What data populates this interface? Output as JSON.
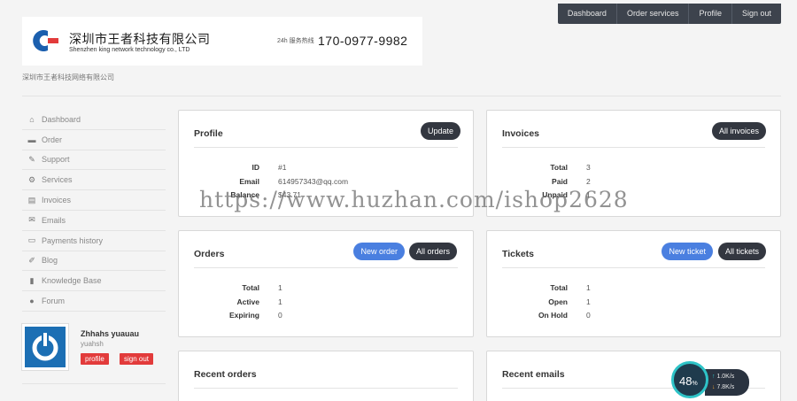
{
  "topnav": {
    "items": [
      "Dashboard",
      "Order services",
      "Profile",
      "Sign out"
    ]
  },
  "header": {
    "company_cn": "深圳市王者科技有限公司",
    "company_en": "Shenzhen king network technology co., LTD",
    "hotline_label": "24h 服务热线",
    "phone": "170-0977-9982",
    "subtitle": "深圳市王者科技网络有限公司"
  },
  "sidebar": {
    "items": [
      {
        "label": "Dashboard",
        "icon": "home-icon",
        "glyph": "⌂"
      },
      {
        "label": "Order",
        "icon": "cart-icon",
        "glyph": "▬"
      },
      {
        "label": "Support",
        "icon": "wrench-icon",
        "glyph": "✎"
      },
      {
        "label": "Services",
        "icon": "gears-icon",
        "glyph": "⚙"
      },
      {
        "label": "Invoices",
        "icon": "file-icon",
        "glyph": "▤"
      },
      {
        "label": "Emails",
        "icon": "envelope-icon",
        "glyph": "✉"
      },
      {
        "label": "Payments history",
        "icon": "credit-card-icon",
        "glyph": "▭"
      },
      {
        "label": "Blog",
        "icon": "edit-icon",
        "glyph": "✐"
      },
      {
        "label": "Knowledge Base",
        "icon": "book-icon",
        "glyph": "▮"
      },
      {
        "label": "Forum",
        "icon": "comments-icon",
        "glyph": "●"
      }
    ]
  },
  "user": {
    "name": "Zhhahs yuauau",
    "handle": "yuahsh",
    "profile_btn": "profile",
    "signout_btn": "sign out"
  },
  "profile": {
    "title": "Profile",
    "button": "Update",
    "rows": [
      {
        "k": "ID",
        "v": "#1"
      },
      {
        "k": "Email",
        "v": "614957343@qq.com"
      },
      {
        "k": "Balance",
        "v": "$43.71"
      }
    ]
  },
  "invoices": {
    "title": "Invoices",
    "button": "All invoices",
    "rows": [
      {
        "k": "Total",
        "v": "3"
      },
      {
        "k": "Paid",
        "v": "2"
      },
      {
        "k": "Unpaid",
        "v": "1"
      }
    ]
  },
  "orders": {
    "title": "Orders",
    "button_new": "New order",
    "button_all": "All orders",
    "rows": [
      {
        "k": "Total",
        "v": "1"
      },
      {
        "k": "Active",
        "v": "1"
      },
      {
        "k": "Expiring",
        "v": "0"
      }
    ]
  },
  "tickets": {
    "title": "Tickets",
    "button_new": "New ticket",
    "button_all": "All tickets",
    "rows": [
      {
        "k": "Total",
        "v": "1"
      },
      {
        "k": "Open",
        "v": "1"
      },
      {
        "k": "On Hold",
        "v": "0"
      }
    ]
  },
  "recent_orders": {
    "title": "Recent orders"
  },
  "recent_emails": {
    "title": "Recent emails"
  },
  "watermark": "https://www.huzhan.com/ishop2628",
  "speed": {
    "percent": "48",
    "percent_unit": "%",
    "up": "1.0K/s",
    "down": "7.8K/s"
  },
  "colors": {
    "accent_blue": "#4a7fe0",
    "dark_button": "#333740",
    "danger": "#e23b3b"
  }
}
